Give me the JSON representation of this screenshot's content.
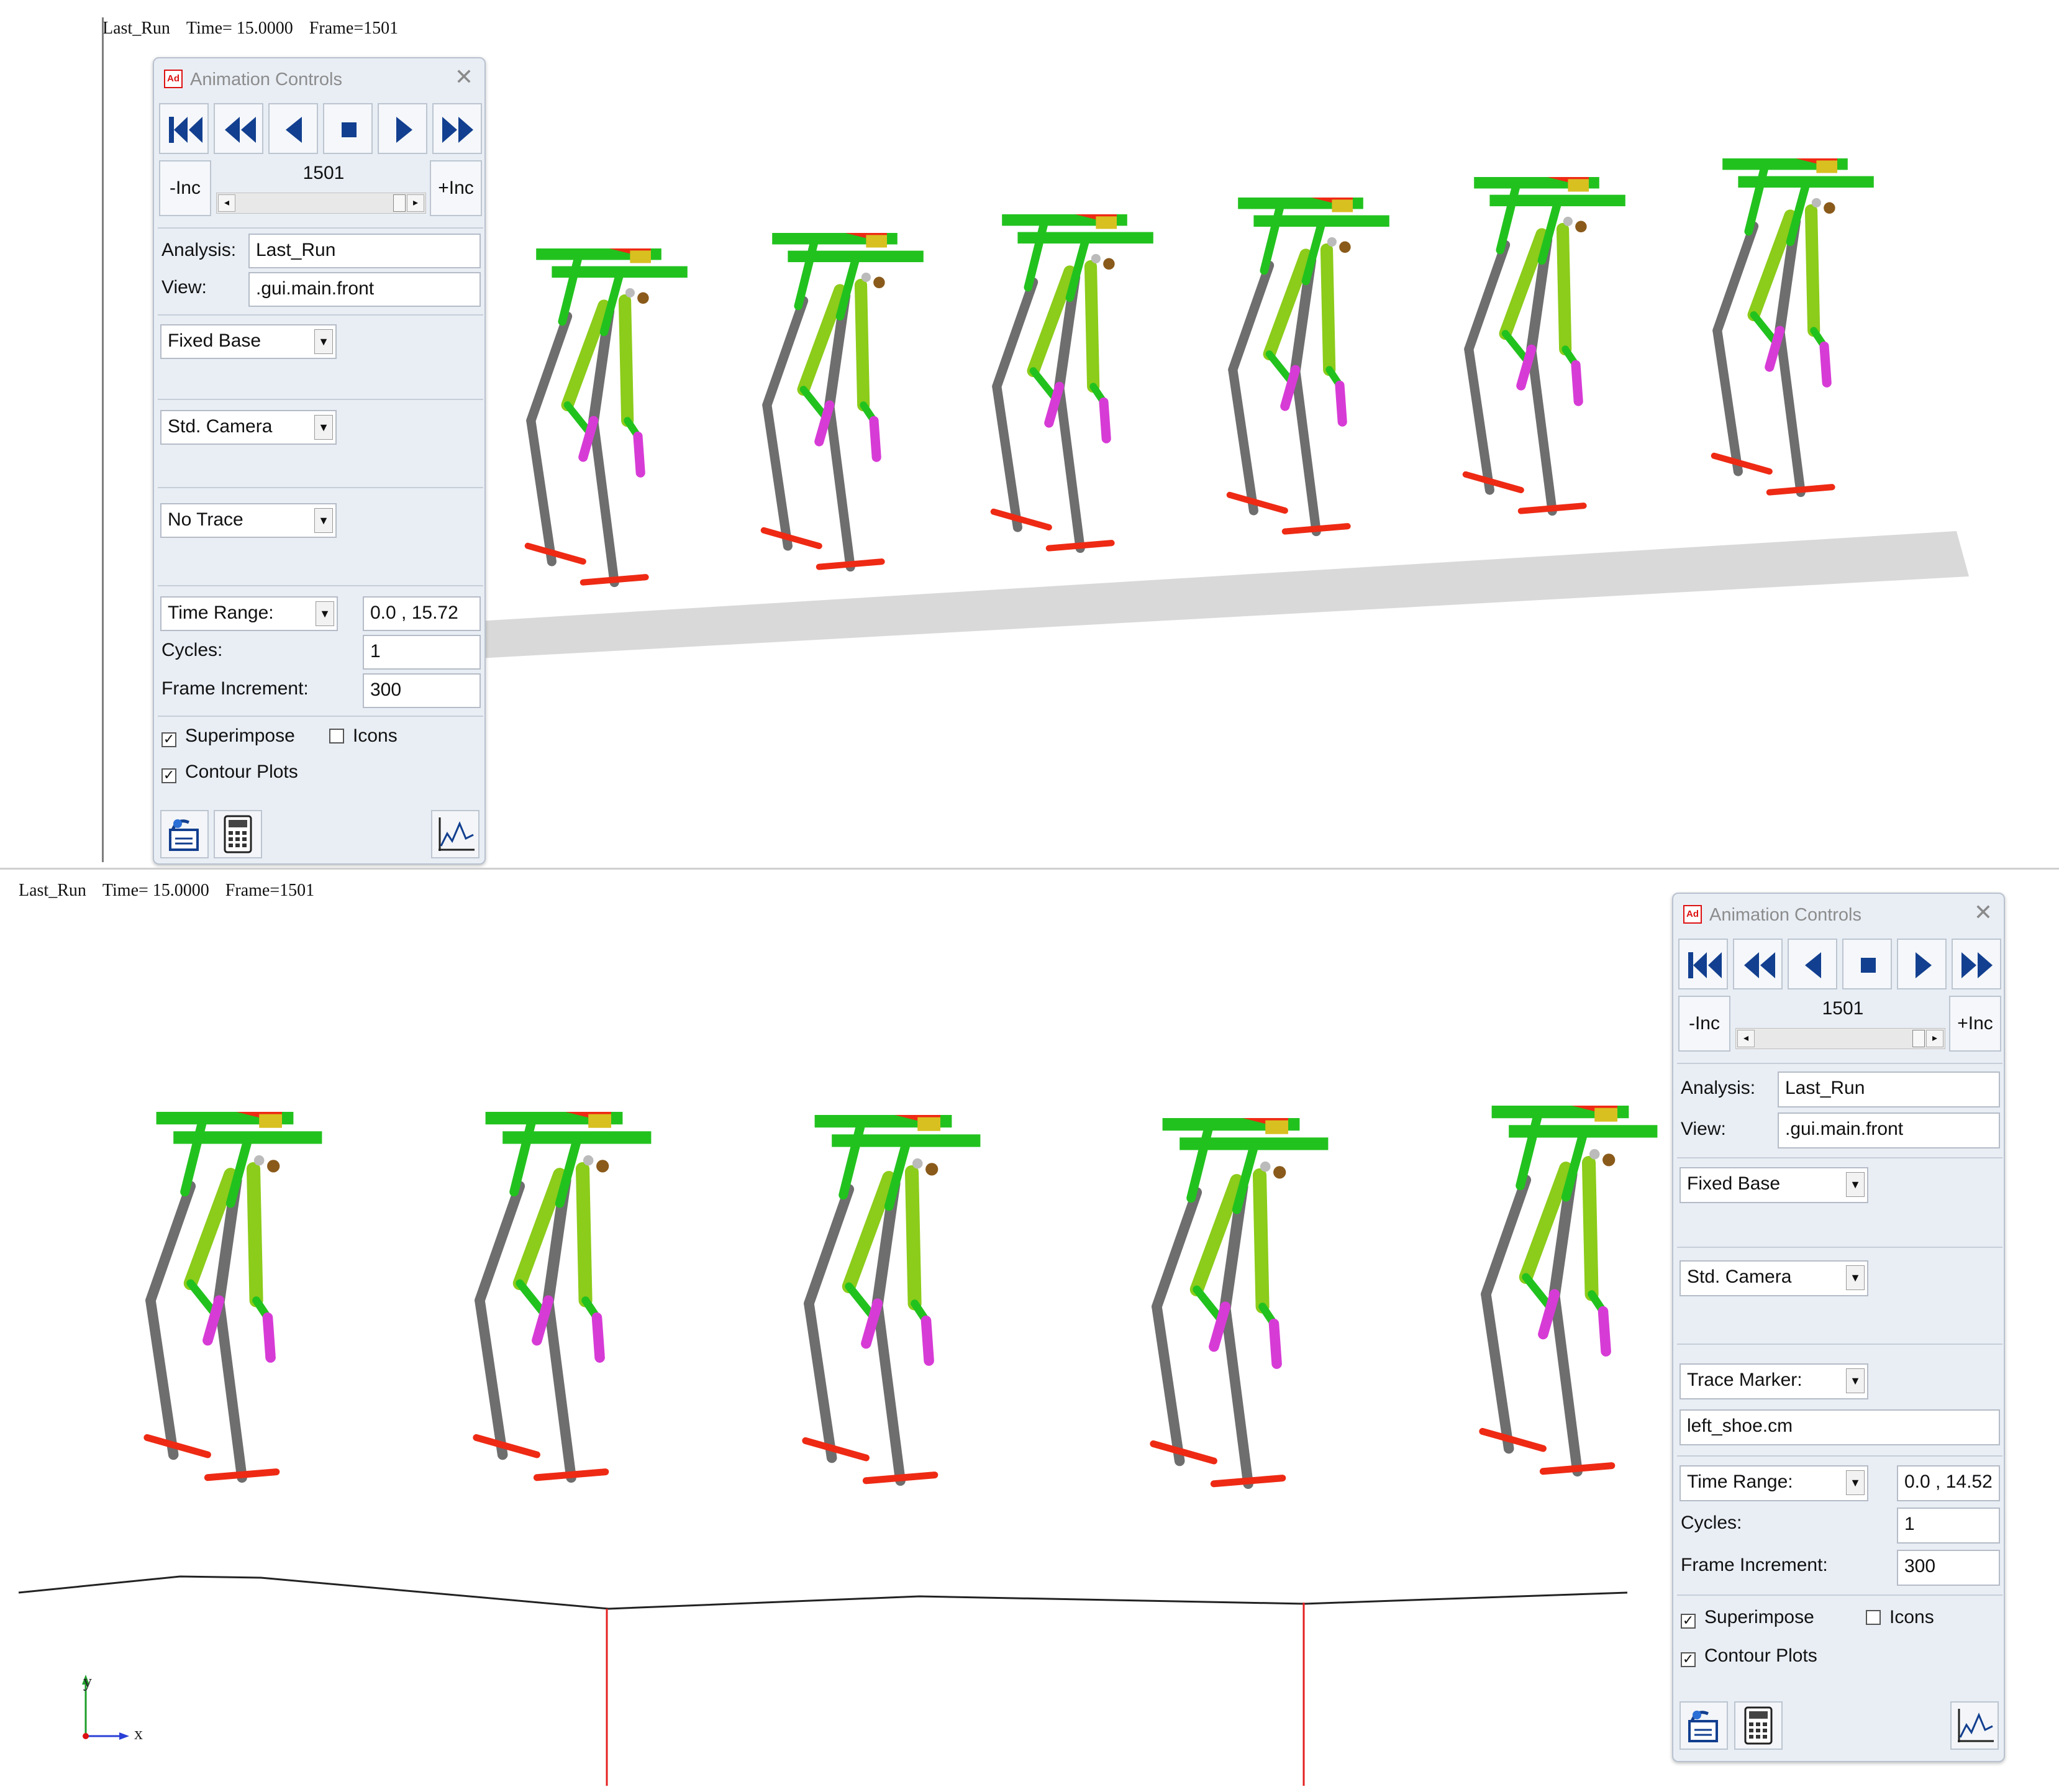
{
  "viewport_top": {
    "header": {
      "analysis": "Last_Run",
      "time": "Time= 15.0000",
      "frame": "Frame=1501"
    }
  },
  "viewport_bottom": {
    "header": {
      "analysis": "Last_Run",
      "time": "Time= 15.0000",
      "frame": "Frame=1501"
    },
    "axis": {
      "y_label": "y",
      "x_label": "x"
    }
  },
  "panel_top": {
    "title": "Animation Controls",
    "app_icon": "Ad",
    "close": "✕",
    "playback_buttons": [
      "skip-to-start-icon",
      "rewind-icon",
      "play-reverse-icon",
      "stop-icon",
      "play-icon",
      "fast-forward-icon"
    ],
    "minus_inc": "-Inc",
    "plus_inc": "+Inc",
    "frame": "1501",
    "analysis_label": "Analysis:",
    "analysis_value": "Last_Run",
    "view_label": "View:",
    "view_value": ".gui.main.front",
    "base_select": "Fixed Base",
    "camera_select": "Std. Camera",
    "trace_select": "No Trace",
    "range_select": "Time Range:",
    "range_value": "0.0 , 15.72",
    "cycles_label": "Cycles:",
    "cycles_value": "1",
    "frame_inc_label": "Frame Increment:",
    "frame_inc_value": "300",
    "superimpose_label": "Superimpose",
    "superimpose_checked": "✓",
    "icons_label": "Icons",
    "contour_label": "Contour Plots",
    "contour_checked": "✓"
  },
  "panel_bottom": {
    "title": "Animation Controls",
    "app_icon": "Ad",
    "close": "✕",
    "minus_inc": "-Inc",
    "plus_inc": "+Inc",
    "frame": "1501",
    "analysis_label": "Analysis:",
    "analysis_value": "Last_Run",
    "view_label": "View:",
    "view_value": ".gui.main.front",
    "base_select": "Fixed Base",
    "camera_select": "Std. Camera",
    "trace_select": "Trace Marker:",
    "trace_value": "left_shoe.cm",
    "range_select": "Time Range:",
    "range_value": "0.0 , 14.52",
    "cycles_label": "Cycles:",
    "cycles_value": "1",
    "frame_inc_label": "Frame Increment:",
    "frame_inc_value": "300",
    "superimpose_label": "Superimpose",
    "superimpose_checked": "✓",
    "icons_label": "Icons",
    "contour_label": "Contour Plots",
    "contour_checked": "✓"
  },
  "colors": {
    "body_green": "#22c21e",
    "thigh_lime": "#8ccc1a",
    "link_grey": "#6e6e6e",
    "foot_red": "#ee2a14",
    "shin_magenta": "#d73bd6",
    "hinge_brown": "#8a5a1a",
    "accent_yellow": "#d8c020",
    "floor_grey": "#d9d9d9",
    "button_blue": "#123f8f"
  }
}
